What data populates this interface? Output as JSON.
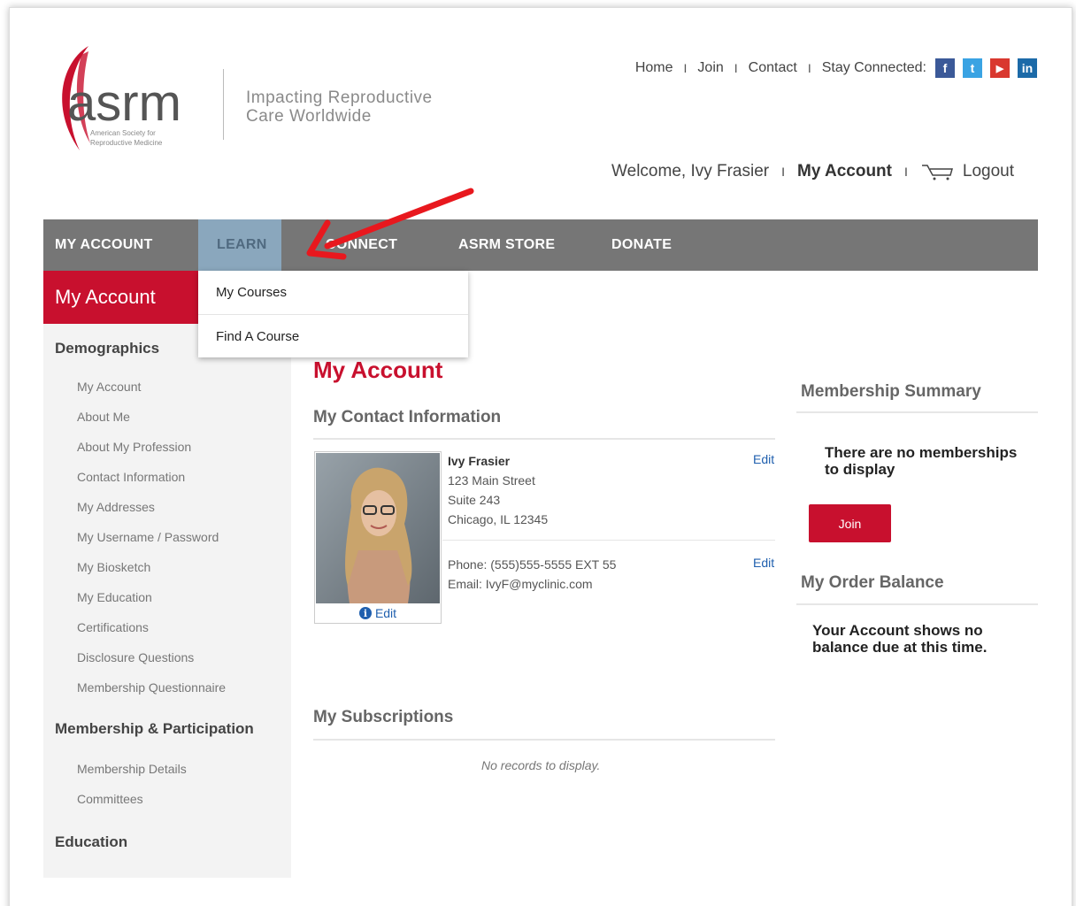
{
  "header": {
    "logo_text": "asrm",
    "logo_subtext_line1": "American Society for",
    "logo_subtext_line2": "Reproductive Medicine",
    "tagline_line1": "Impacting Reproductive",
    "tagline_line2": "Care Worldwide"
  },
  "top_links": {
    "home": "Home",
    "join": "Join",
    "contact": "Contact",
    "stay_connected": "Stay Connected:",
    "separator": "I",
    "social": [
      {
        "icon": "facebook-icon",
        "glyph": "f",
        "color": "#3b5998"
      },
      {
        "icon": "twitter-icon",
        "glyph": "t",
        "color": "#3aa3e3"
      },
      {
        "icon": "youtube-icon",
        "glyph": "▶",
        "color": "#d9382f"
      },
      {
        "icon": "linkedin-icon",
        "glyph": "in",
        "color": "#1c6aa8"
      }
    ]
  },
  "welcome": {
    "greeting": "Welcome, Ivy Frasier",
    "my_account": "My Account",
    "logout": "Logout"
  },
  "nav": {
    "items": [
      "MY ACCOUNT",
      "LEARN",
      "CONNECT",
      "ASRM STORE",
      "DONATE"
    ],
    "dropdown": [
      "My Courses",
      "Find A Course"
    ]
  },
  "sidebar": {
    "heading": "My Account",
    "sections": [
      {
        "title": "Demographics",
        "links": [
          "My Account",
          "About Me",
          "About My Profession",
          "Contact Information",
          "My Addresses",
          "My Username / Password",
          "My Biosketch",
          "My Education",
          "Certifications",
          "Disclosure Questions",
          "Membership Questionnaire"
        ]
      },
      {
        "title": "Membership & Participation",
        "links": [
          "Membership Details",
          "Committees"
        ]
      },
      {
        "title": "Education",
        "links": []
      }
    ]
  },
  "main": {
    "title": "My Account",
    "contact_heading": "My Contact Information",
    "photo_edit": "Edit",
    "name": "Ivy Frasier",
    "address1": "123 Main Street",
    "address2": "Suite 243",
    "city_state_zip": "Chicago, IL   12345",
    "phone": "Phone: (555)555-5555 EXT 55",
    "email": "Email: IvyF@myclinic.com",
    "edit": "Edit",
    "subscriptions_heading": "My Subscriptions",
    "no_records": "No records to display."
  },
  "right": {
    "membership_heading": "Membership Summary",
    "no_memberships": "There are no memberships to display",
    "join_button": "Join",
    "order_heading": "My Order Balance",
    "no_balance": "Your Account shows no balance due at this time."
  },
  "colors": {
    "brand_red": "#c8102e",
    "nav_gray": "#767676",
    "nav_active": "#8aa7bd",
    "link_blue": "#1f5fae"
  }
}
